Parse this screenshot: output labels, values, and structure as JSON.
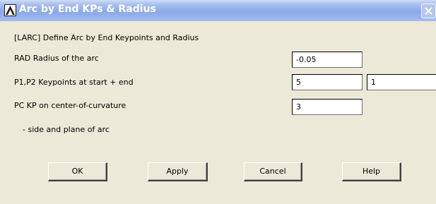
{
  "window": {
    "title": "Arc by End KPs & Radius",
    "close_glyph": "✕",
    "logo_icon": "ansys-logo-icon"
  },
  "form": {
    "heading": "[LARC]  Define Arc by End Keypoints and Radius",
    "rad_label": "RAD   Radius of the arc",
    "rad_value": "-0.05",
    "p1p2_label": "P1,P2  Keypoints at start + end",
    "p1_value": "5",
    "p2_value": "1",
    "pc_label": "PC    KP on center-of-curvature",
    "pc_sub_label": "- side and plane of arc",
    "pc_value": "3"
  },
  "buttons": {
    "ok": "OK",
    "apply": "Apply",
    "cancel": "Cancel",
    "help": "Help"
  },
  "colors": {
    "titlebar": "#8aa8e8",
    "background": "#ece9d8"
  }
}
